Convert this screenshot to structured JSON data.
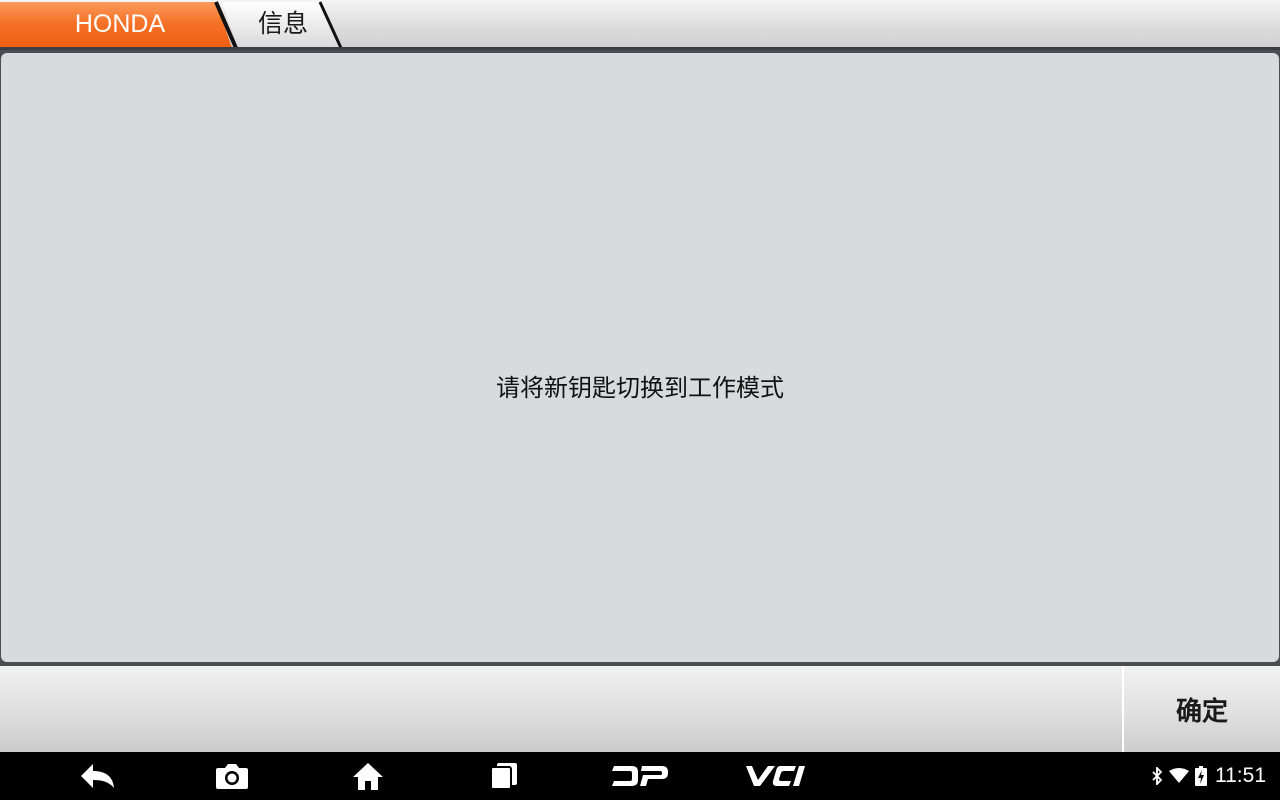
{
  "breadcrumb": {
    "items": [
      {
        "label": "HONDA",
        "active": true
      },
      {
        "label": "信息",
        "active": false
      }
    ]
  },
  "message": {
    "text": "请将新钥匙切换到工作模式"
  },
  "actions": {
    "confirm_label": "确定"
  },
  "navbar": {
    "buttons": [
      "back-icon",
      "camera-icon",
      "home-icon",
      "recents-icon",
      "dp-icon",
      "vci-icon"
    ],
    "dp_label": "DP",
    "vci_label": "VCI"
  },
  "status": {
    "time": "11:51",
    "icons": [
      "bluetooth-icon",
      "wifi-icon",
      "battery-charging-icon"
    ]
  },
  "colors": {
    "accent": "#f26a1b",
    "panel": "#d8dbde",
    "navbar": "#000000"
  }
}
